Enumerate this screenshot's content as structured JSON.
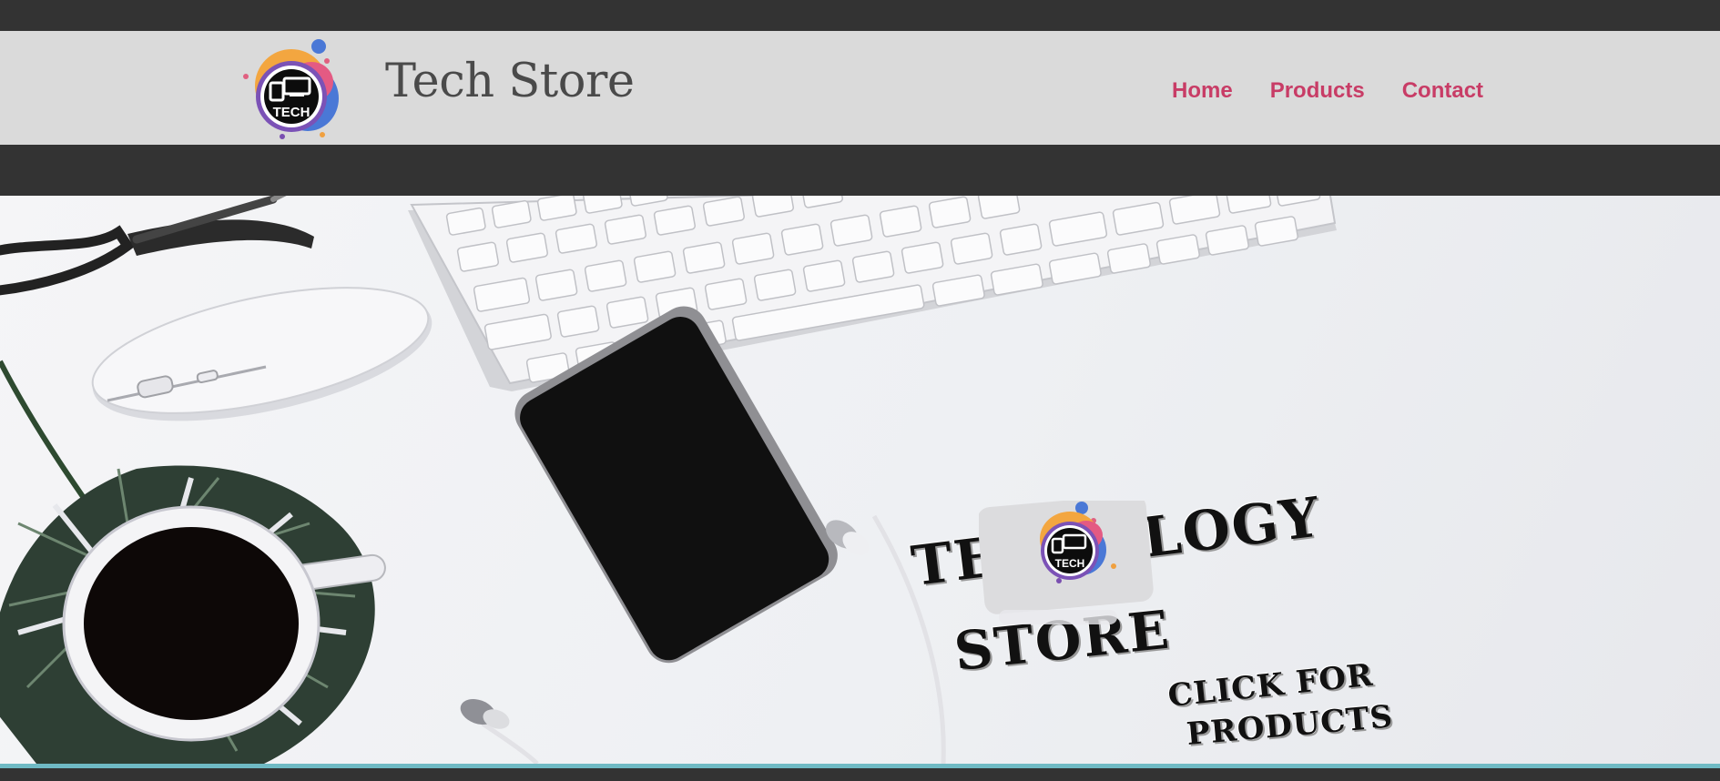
{
  "header": {
    "title": "Tech Store",
    "logo_text": "TECH"
  },
  "nav": {
    "items": [
      {
        "label": "Home"
      },
      {
        "label": "Products"
      },
      {
        "label": "Contact"
      }
    ]
  },
  "hero": {
    "title_line1": "TECNOLOGY",
    "title_line2": "STORE",
    "cta_line1": "CLICK FOR",
    "cta_line2": "PRODUCTS",
    "badge_text": "TECH"
  },
  "colors": {
    "nav_link": "#c83c66",
    "header_bg": "#dadada",
    "page_bg": "#333333",
    "accent_line": "#6fbac4"
  },
  "icons": [
    "tech-logo-icon",
    "glasses-icon",
    "keyboard-icon",
    "mouse-icon",
    "phone-icon",
    "earbuds-icon",
    "coffee-cup-icon",
    "plant-leaf-icon"
  ]
}
